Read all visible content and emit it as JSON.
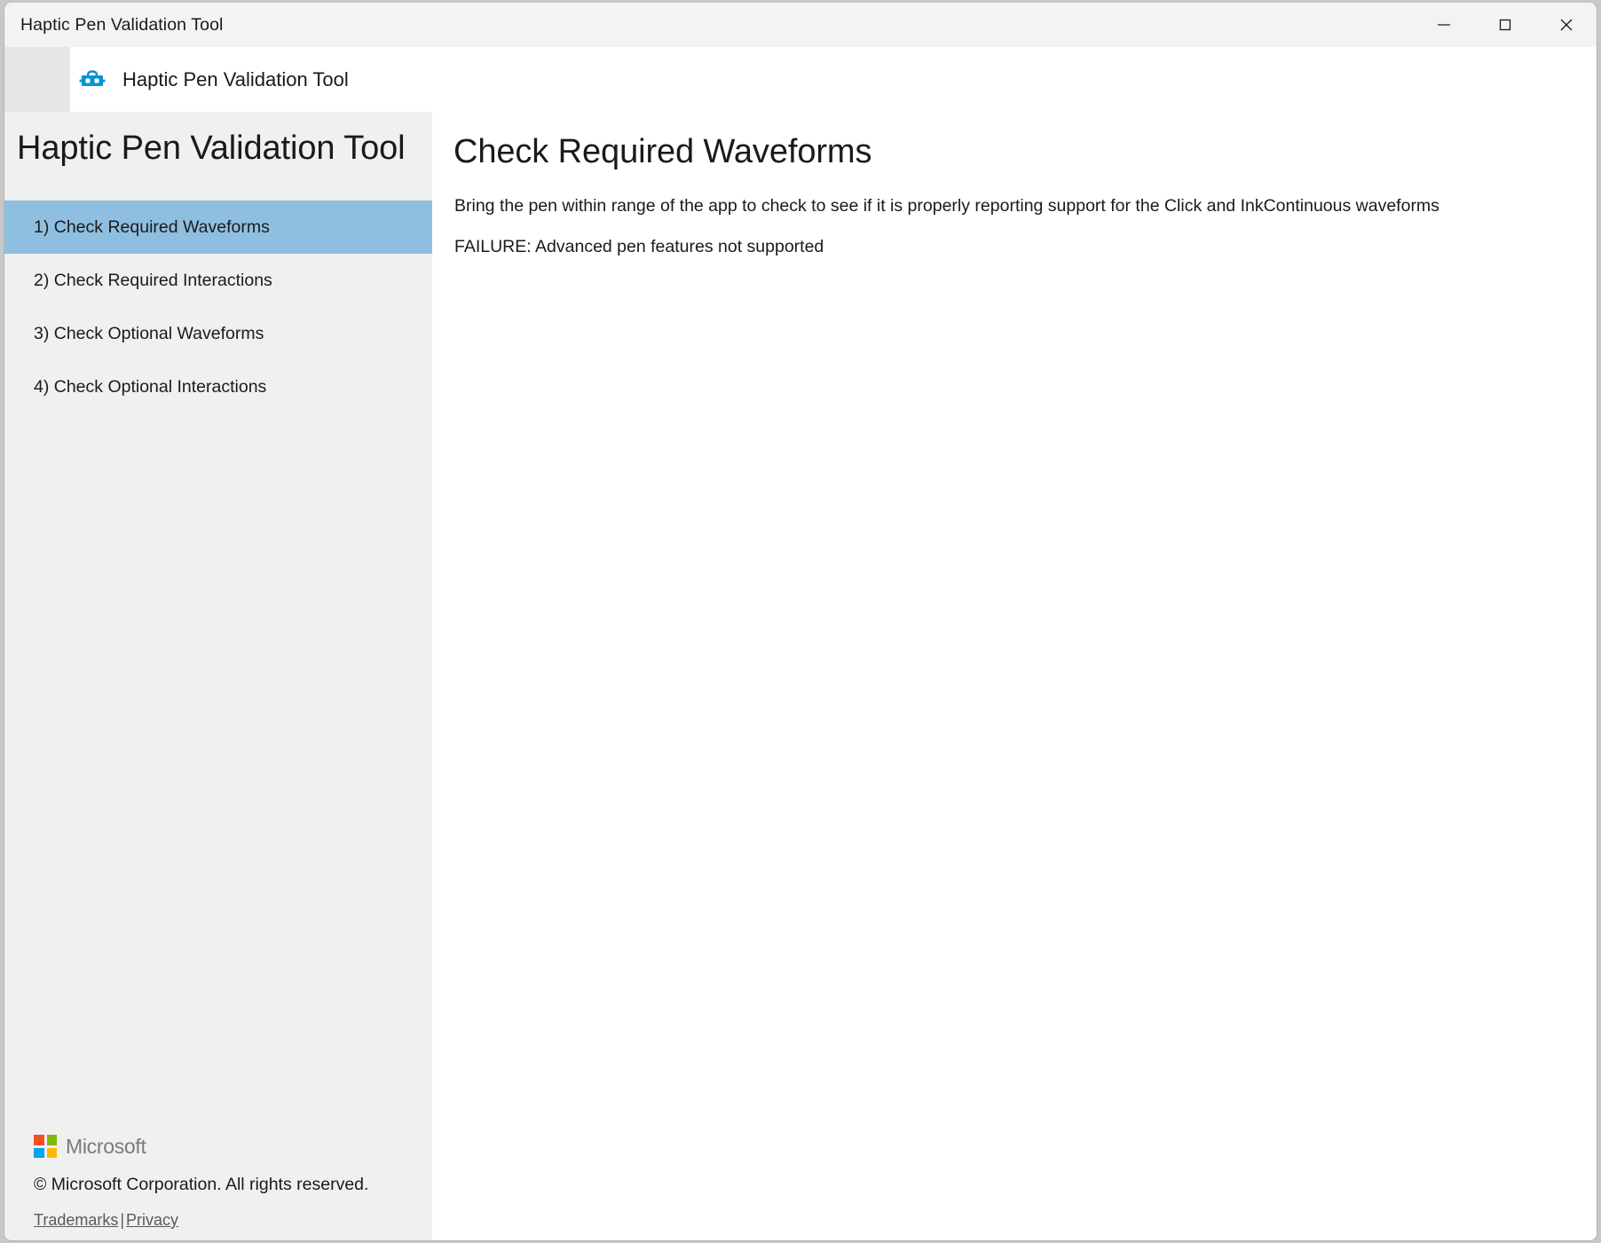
{
  "window": {
    "title": "Haptic Pen Validation Tool",
    "controls": [
      {
        "name": "minimize",
        "label": "—"
      },
      {
        "name": "maximize",
        "label": "□"
      },
      {
        "name": "close",
        "label": "✕"
      }
    ]
  },
  "header": {
    "icon": "toolbox-icon",
    "title": "Haptic Pen Validation Tool",
    "menu_icon": "hamburger-menu-icon"
  },
  "sidebar": {
    "heading": "Haptic Pen Validation Tool",
    "items": [
      {
        "label": "1) Check Required Waveforms",
        "selected": true
      },
      {
        "label": "2) Check Required Interactions",
        "selected": false
      },
      {
        "label": "3) Check Optional Waveforms",
        "selected": false
      },
      {
        "label": "4) Check Optional Interactions",
        "selected": false
      }
    ],
    "footer": {
      "logo_icon": "microsoft-logo-icon",
      "logo_text": "Microsoft",
      "copyright": "© Microsoft Corporation. All rights reserved.",
      "trademarks_link": "Trademarks",
      "separator": "|",
      "privacy_link": "Privacy"
    }
  },
  "main": {
    "title": "Check Required Waveforms",
    "description": "Bring the pen within range of the app to check to see if it is properly reporting support for the Click and InkContinuous waveforms",
    "status": "FAILURE: Advanced pen features not supported"
  },
  "colors": {
    "accent_blue": "#0a93d4",
    "selection_blue": "#8fbfe0",
    "titlebar_bg": "#f3f3f3",
    "sidebar_bg": "#f0f0f0",
    "menu_panel_bg": "#e6e6e6",
    "content_bg": "#ffffff",
    "logo_orange": "#f25022",
    "logo_green": "#7fba00",
    "logo_blue": "#00a4ef",
    "logo_yellow": "#ffb900"
  }
}
